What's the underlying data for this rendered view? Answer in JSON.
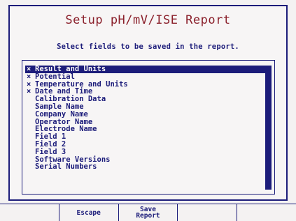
{
  "window": {
    "title": "Setup pH/mV/ISE Report",
    "instruction": "Select fields to be saved in the report."
  },
  "fields": [
    {
      "label": "Result and Units",
      "checked": true,
      "selected": true
    },
    {
      "label": "Potential",
      "checked": true,
      "selected": false
    },
    {
      "label": "Temperature and Units",
      "checked": true,
      "selected": false
    },
    {
      "label": "Date and Time",
      "checked": true,
      "selected": false
    },
    {
      "label": "Calibration Data",
      "checked": false,
      "selected": false
    },
    {
      "label": "Sample Name",
      "checked": false,
      "selected": false
    },
    {
      "label": "Company Name",
      "checked": false,
      "selected": false
    },
    {
      "label": "Operator Name",
      "checked": false,
      "selected": false
    },
    {
      "label": "Electrode Name",
      "checked": false,
      "selected": false
    },
    {
      "label": "Field 1",
      "checked": false,
      "selected": false
    },
    {
      "label": "Field 2",
      "checked": false,
      "selected": false
    },
    {
      "label": "Field 3",
      "checked": false,
      "selected": false
    },
    {
      "label": "Software Versions",
      "checked": false,
      "selected": false
    },
    {
      "label": "Serial Numbers",
      "checked": false,
      "selected": false
    }
  ],
  "check_mark": "×",
  "softkeys": [
    {
      "label": ""
    },
    {
      "label": "Escape"
    },
    {
      "label": "Save\nReport"
    },
    {
      "label": ""
    },
    {
      "label": ""
    }
  ],
  "colors": {
    "title": "#8a1f2a",
    "text": "#1c1c7a",
    "highlight": "#1c1c7a",
    "background": "#f7f5f5"
  }
}
